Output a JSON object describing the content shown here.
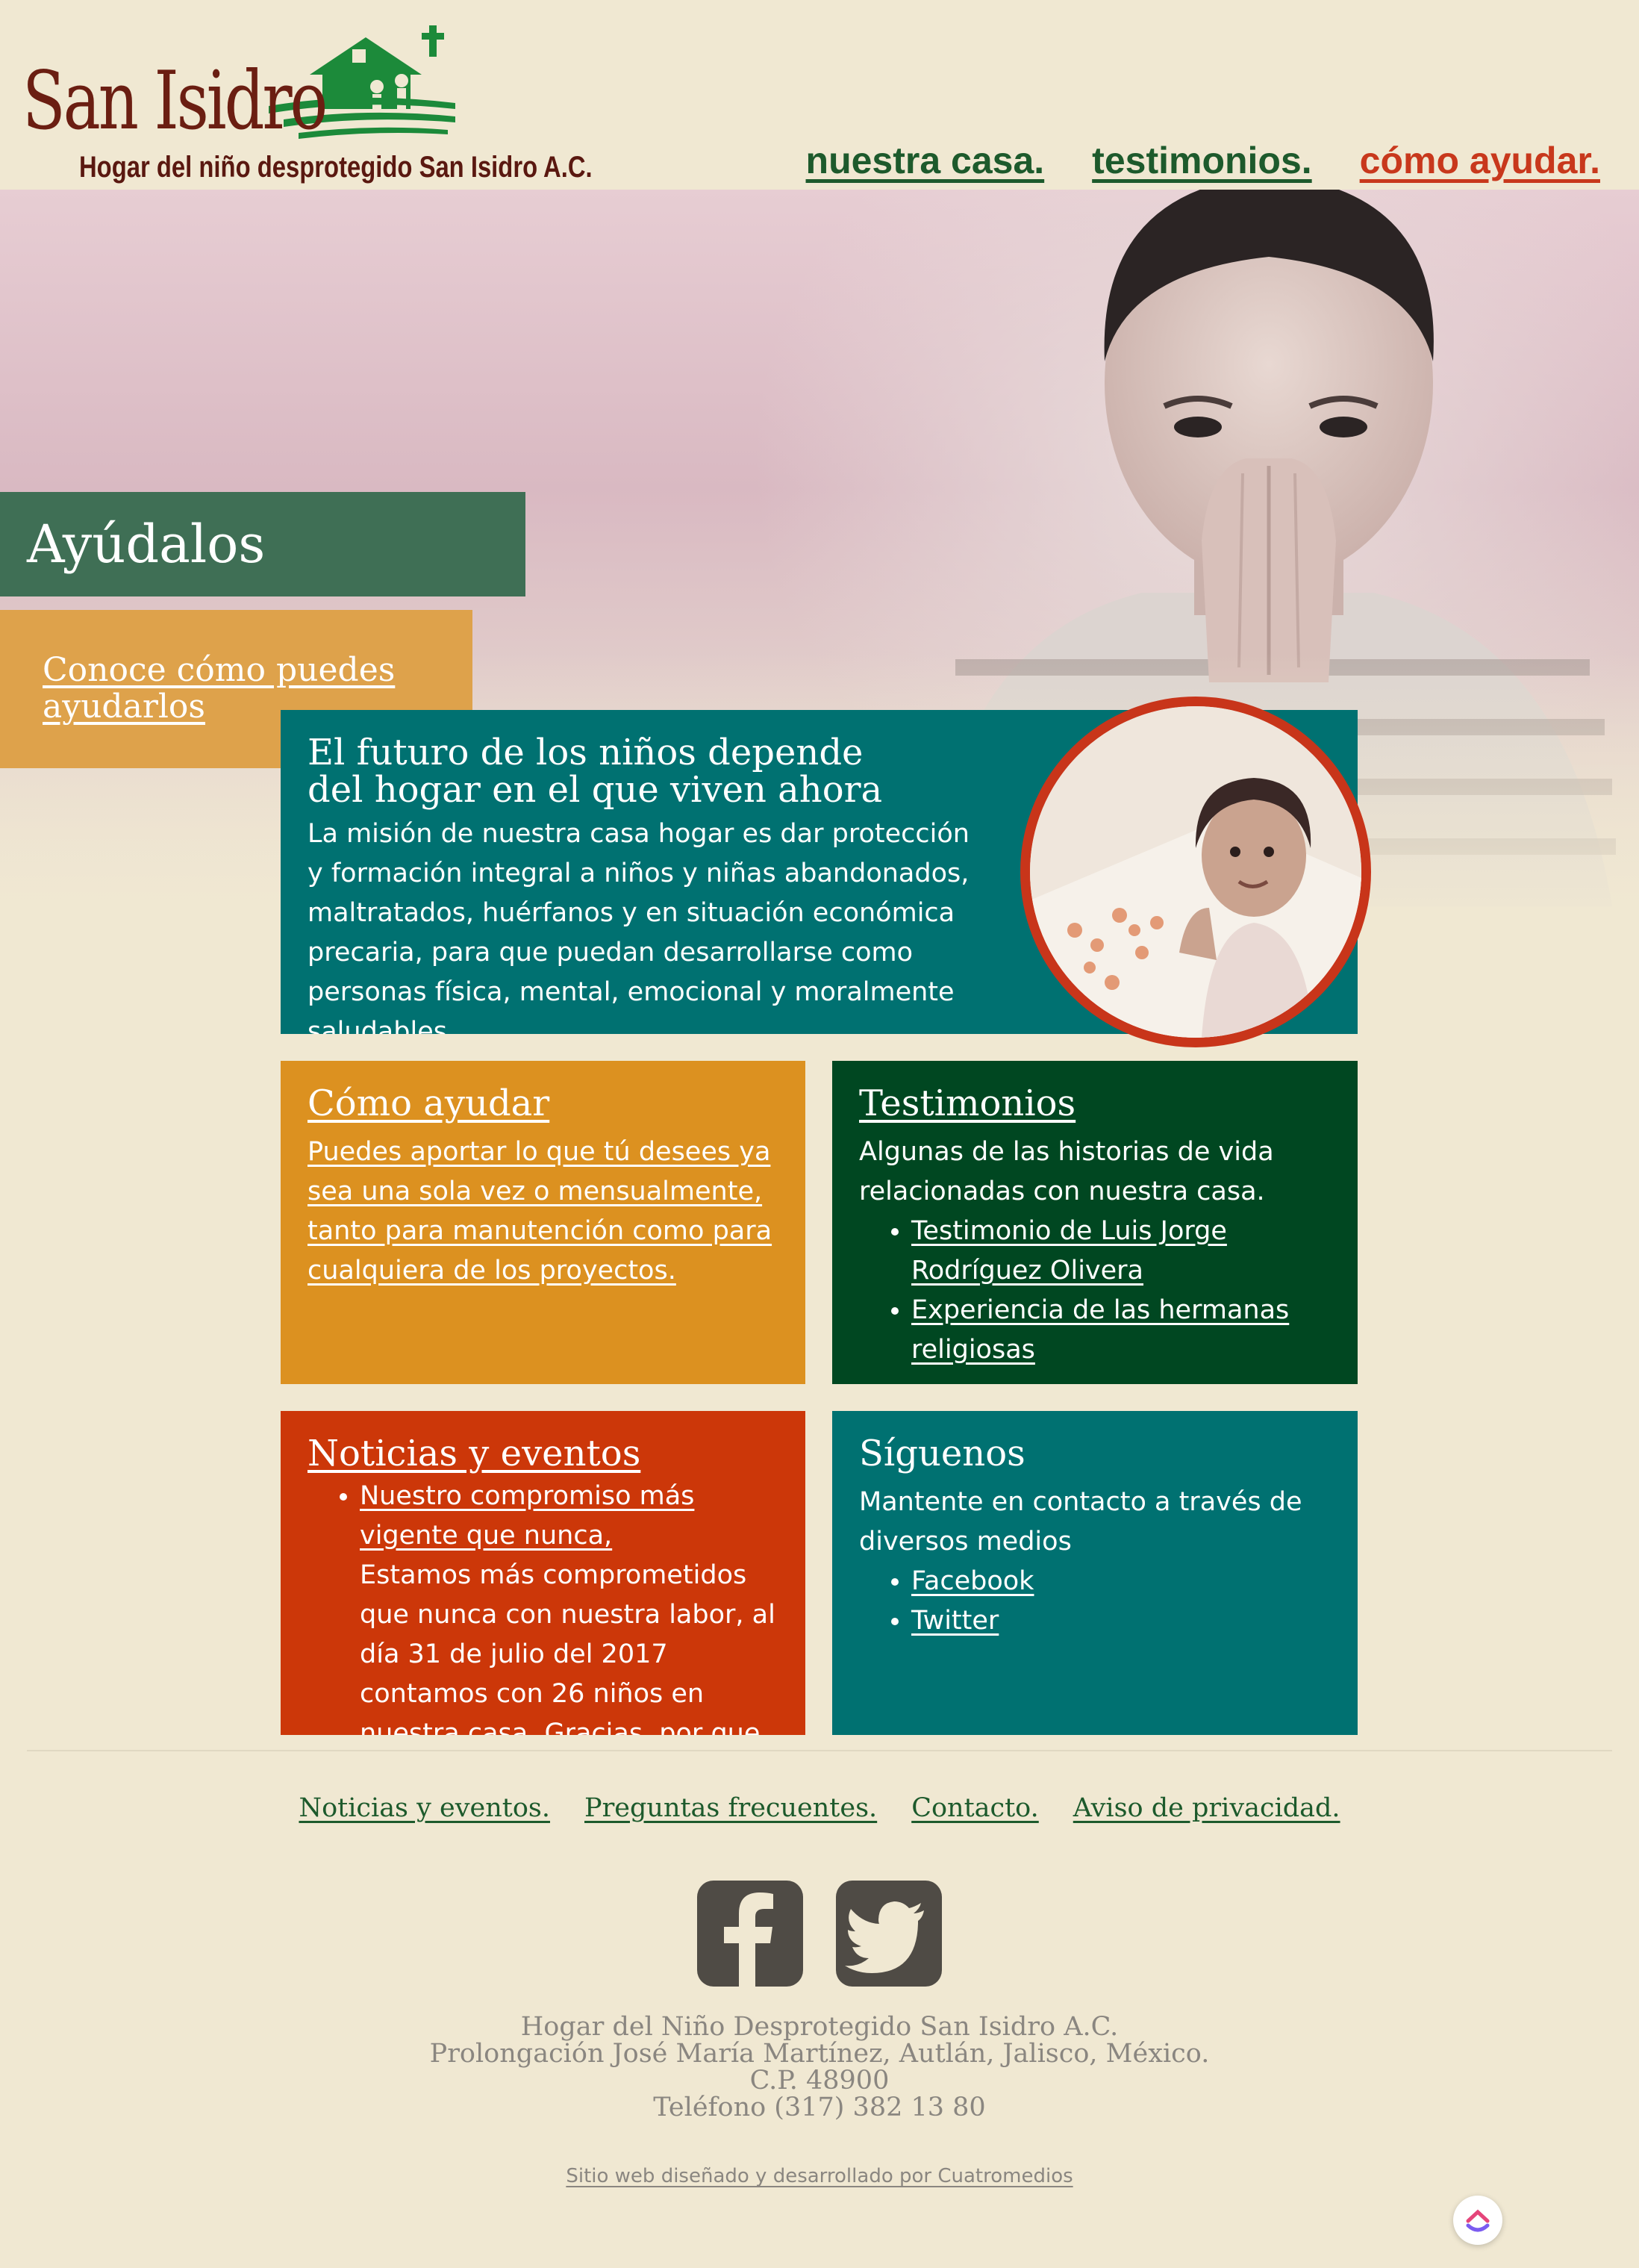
{
  "header": {
    "logo_title": "San Isidro",
    "logo_subtitle": "Hogar del niño desprotegido San Isidro A.C.",
    "nav": [
      {
        "label": "nuestra casa.",
        "color": "#1d5a2c"
      },
      {
        "label": "testimonios.",
        "color": "#1d5a2c"
      },
      {
        "label": "cómo ayudar.",
        "color": "#c8381c"
      }
    ]
  },
  "hero": {
    "title": "Ayúdalos",
    "link": "Conoce cómo puedes ayudarlos"
  },
  "mission": {
    "title": "El futuro de los niños depende del hogar en el que viven ahora",
    "body": "La misión de nuestra casa hogar es dar protección y formación integral a niños y niñas abandonados, maltratados, huérfanos y en situación económica precaria, para que puedan desarrollarse como personas física, mental, emocional y moralmente saludables."
  },
  "cards": {
    "como": {
      "title": "Cómo ayudar",
      "body": "Puedes aportar lo que tú desees ya sea una sola vez o mensualmente, tanto para manutención como para cualquiera de los proyectos."
    },
    "testimonios": {
      "title": "Testimonios",
      "body": "Algunas de las historias de vida relacionadas con nuestra casa.",
      "items": [
        "Testimonio de Luis Jorge Rodríguez Olivera",
        "Experiencia de las hermanas religiosas"
      ]
    },
    "noticias": {
      "title": "Noticias y eventos",
      "item_link": "Nuestro compromiso más vigente que nunca,",
      "item_text": "Estamos más comprometidos que nunca con nuestra labor, al día 31 de julio del 2017 contamos con 26 niños en nuestra casa. Gracias, por que con su ayuda, seguimos"
    },
    "siguenos": {
      "title": "Síguenos",
      "body": "Mantente en contacto a través de diversos medios",
      "items": [
        "Facebook",
        "Twitter"
      ]
    }
  },
  "footer": {
    "links": [
      "Noticias y eventos.",
      "Preguntas frecuentes.",
      "Contacto.",
      "Aviso de privacidad."
    ],
    "social_icons": [
      "facebook-icon",
      "twitter-icon"
    ],
    "address": [
      "Hogar del Niño Desprotegido San Isidro A.C.",
      "Prolongación José María Martínez, Autlán, Jalisco, México.",
      "C.P. 48900",
      "Teléfono (317) 382 13 80"
    ],
    "credit": "Sitio web diseñado y desarrollado por Cuatromedios"
  },
  "colors": {
    "background": "#f0e8d2",
    "green_dark": "#004721",
    "teal": "#007171",
    "orange": "#dc9120",
    "red": "#cc3709",
    "hero_green": "#3f6f55",
    "hero_orange": "#dea24b",
    "logo_brown": "#6b1e12"
  }
}
